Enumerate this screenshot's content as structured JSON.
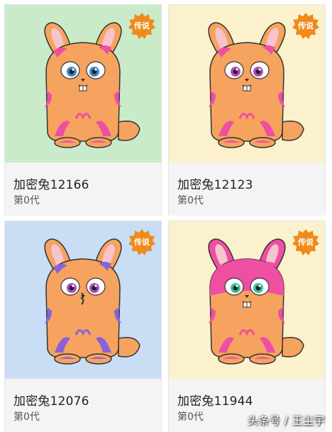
{
  "badge_label": "传说",
  "watermark": "头条号 / 王尘宇",
  "cards": [
    {
      "name": "加密兔12166",
      "generation": "第0代",
      "background": "#c9ebc9",
      "body_color": "#f5a35f",
      "spot_color": "#ee4fa3",
      "eye_color": "#3d86c9",
      "mouth": "teeth"
    },
    {
      "name": "加密兔12123",
      "generation": "第0代",
      "background": "#fbf1cd",
      "body_color": "#f5a35f",
      "spot_color": "#ee4fa3",
      "eye_color": "#b24db8",
      "mouth": "teeth"
    },
    {
      "name": "加密兔12076",
      "generation": "第0代",
      "background": "#c9ddf5",
      "body_color": "#f5a35f",
      "spot_color": "#8a62d8",
      "eye_color": "#b24db8",
      "mouth": "kiss"
    },
    {
      "name": "加密兔11944",
      "generation": "第0代",
      "background": "#fbf1cd",
      "body_color": "#f5a35f",
      "spot_color": "#ee4fa3",
      "eye_color": "#3dbfa0",
      "mouth": "teeth"
    }
  ]
}
